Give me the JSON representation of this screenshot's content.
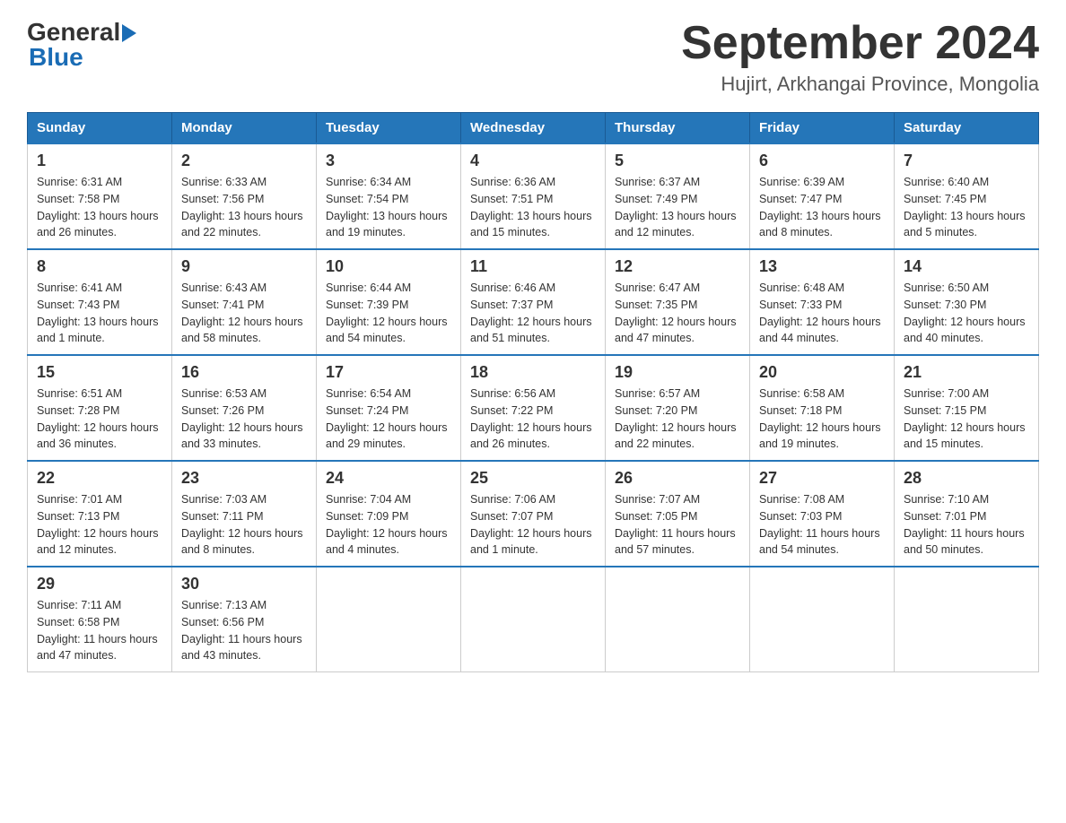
{
  "header": {
    "logo_general": "General",
    "logo_blue": "Blue",
    "title": "September 2024",
    "subtitle": "Hujirt, Arkhangai Province, Mongolia"
  },
  "days_of_week": [
    "Sunday",
    "Monday",
    "Tuesday",
    "Wednesday",
    "Thursday",
    "Friday",
    "Saturday"
  ],
  "weeks": [
    [
      {
        "day": "1",
        "sunrise": "6:31 AM",
        "sunset": "7:58 PM",
        "daylight": "13 hours and 26 minutes."
      },
      {
        "day": "2",
        "sunrise": "6:33 AM",
        "sunset": "7:56 PM",
        "daylight": "13 hours and 22 minutes."
      },
      {
        "day": "3",
        "sunrise": "6:34 AM",
        "sunset": "7:54 PM",
        "daylight": "13 hours and 19 minutes."
      },
      {
        "day": "4",
        "sunrise": "6:36 AM",
        "sunset": "7:51 PM",
        "daylight": "13 hours and 15 minutes."
      },
      {
        "day": "5",
        "sunrise": "6:37 AM",
        "sunset": "7:49 PM",
        "daylight": "13 hours and 12 minutes."
      },
      {
        "day": "6",
        "sunrise": "6:39 AM",
        "sunset": "7:47 PM",
        "daylight": "13 hours and 8 minutes."
      },
      {
        "day": "7",
        "sunrise": "6:40 AM",
        "sunset": "7:45 PM",
        "daylight": "13 hours and 5 minutes."
      }
    ],
    [
      {
        "day": "8",
        "sunrise": "6:41 AM",
        "sunset": "7:43 PM",
        "daylight": "13 hours and 1 minute."
      },
      {
        "day": "9",
        "sunrise": "6:43 AM",
        "sunset": "7:41 PM",
        "daylight": "12 hours and 58 minutes."
      },
      {
        "day": "10",
        "sunrise": "6:44 AM",
        "sunset": "7:39 PM",
        "daylight": "12 hours and 54 minutes."
      },
      {
        "day": "11",
        "sunrise": "6:46 AM",
        "sunset": "7:37 PM",
        "daylight": "12 hours and 51 minutes."
      },
      {
        "day": "12",
        "sunrise": "6:47 AM",
        "sunset": "7:35 PM",
        "daylight": "12 hours and 47 minutes."
      },
      {
        "day": "13",
        "sunrise": "6:48 AM",
        "sunset": "7:33 PM",
        "daylight": "12 hours and 44 minutes."
      },
      {
        "day": "14",
        "sunrise": "6:50 AM",
        "sunset": "7:30 PM",
        "daylight": "12 hours and 40 minutes."
      }
    ],
    [
      {
        "day": "15",
        "sunrise": "6:51 AM",
        "sunset": "7:28 PM",
        "daylight": "12 hours and 36 minutes."
      },
      {
        "day": "16",
        "sunrise": "6:53 AM",
        "sunset": "7:26 PM",
        "daylight": "12 hours and 33 minutes."
      },
      {
        "day": "17",
        "sunrise": "6:54 AM",
        "sunset": "7:24 PM",
        "daylight": "12 hours and 29 minutes."
      },
      {
        "day": "18",
        "sunrise": "6:56 AM",
        "sunset": "7:22 PM",
        "daylight": "12 hours and 26 minutes."
      },
      {
        "day": "19",
        "sunrise": "6:57 AM",
        "sunset": "7:20 PM",
        "daylight": "12 hours and 22 minutes."
      },
      {
        "day": "20",
        "sunrise": "6:58 AM",
        "sunset": "7:18 PM",
        "daylight": "12 hours and 19 minutes."
      },
      {
        "day": "21",
        "sunrise": "7:00 AM",
        "sunset": "7:15 PM",
        "daylight": "12 hours and 15 minutes."
      }
    ],
    [
      {
        "day": "22",
        "sunrise": "7:01 AM",
        "sunset": "7:13 PM",
        "daylight": "12 hours and 12 minutes."
      },
      {
        "day": "23",
        "sunrise": "7:03 AM",
        "sunset": "7:11 PM",
        "daylight": "12 hours and 8 minutes."
      },
      {
        "day": "24",
        "sunrise": "7:04 AM",
        "sunset": "7:09 PM",
        "daylight": "12 hours and 4 minutes."
      },
      {
        "day": "25",
        "sunrise": "7:06 AM",
        "sunset": "7:07 PM",
        "daylight": "12 hours and 1 minute."
      },
      {
        "day": "26",
        "sunrise": "7:07 AM",
        "sunset": "7:05 PM",
        "daylight": "11 hours and 57 minutes."
      },
      {
        "day": "27",
        "sunrise": "7:08 AM",
        "sunset": "7:03 PM",
        "daylight": "11 hours and 54 minutes."
      },
      {
        "day": "28",
        "sunrise": "7:10 AM",
        "sunset": "7:01 PM",
        "daylight": "11 hours and 50 minutes."
      }
    ],
    [
      {
        "day": "29",
        "sunrise": "7:11 AM",
        "sunset": "6:58 PM",
        "daylight": "11 hours and 47 minutes."
      },
      {
        "day": "30",
        "sunrise": "7:13 AM",
        "sunset": "6:56 PM",
        "daylight": "11 hours and 43 minutes."
      },
      null,
      null,
      null,
      null,
      null
    ]
  ],
  "labels": {
    "sunrise": "Sunrise:",
    "sunset": "Sunset:",
    "daylight": "Daylight:"
  }
}
